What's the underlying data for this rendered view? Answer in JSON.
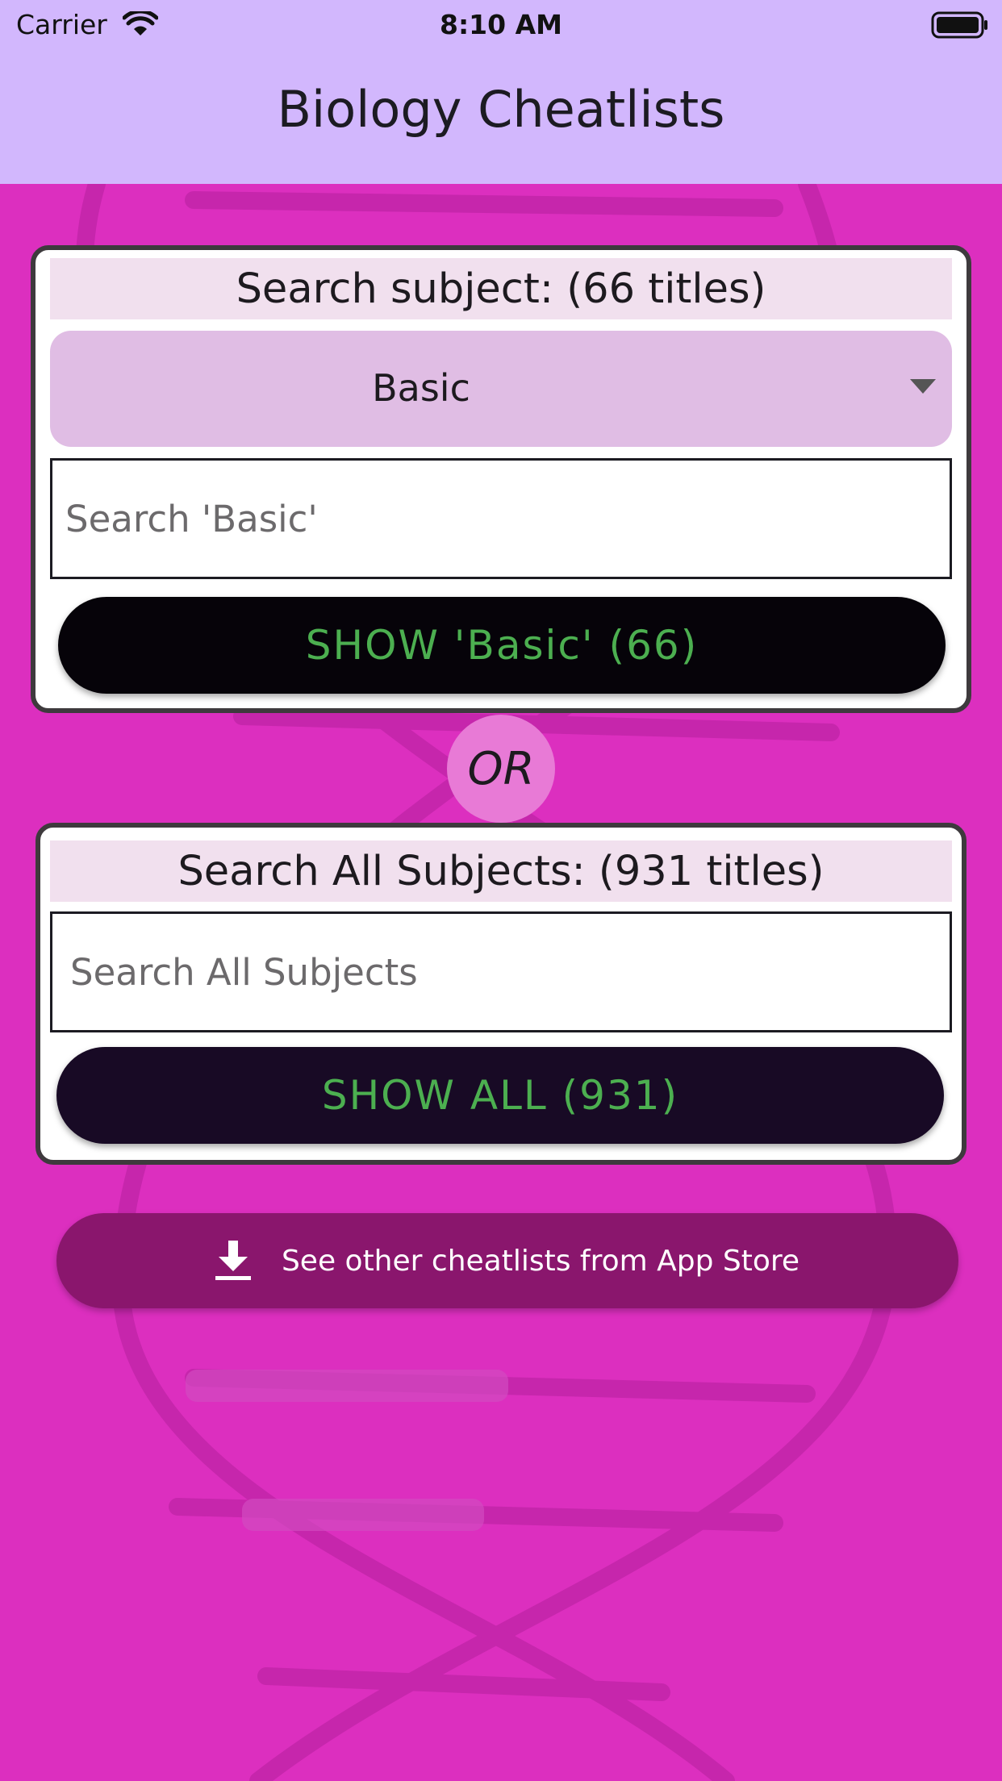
{
  "status_bar": {
    "carrier": "Carrier",
    "time": "8:10 AM",
    "icons": [
      "wifi-icon",
      "battery-icon"
    ]
  },
  "app_bar": {
    "title": "Biology Cheatlists"
  },
  "subject_section": {
    "header": "Search subject: (66 titles)",
    "dropdown": {
      "selected": "Basic",
      "icon": "dropdown-arrow-icon"
    },
    "search": {
      "value": "",
      "placeholder": "Search 'Basic'"
    },
    "show_button": "SHOW 'Basic' (66)"
  },
  "divider": {
    "label": "OR"
  },
  "all_section": {
    "header": "Search All Subjects: (931 titles)",
    "search": {
      "value": "",
      "placeholder": "Search All Subjects"
    },
    "show_button": "SHOW ALL (931)"
  },
  "store_button": {
    "label": "See other cheatlists from App Store",
    "icon": "download-icon"
  },
  "colors": {
    "app_bar": "#d2b7fd",
    "background": "#dc2fbf",
    "button_text": "#4caf50",
    "store_button": "#8a166d",
    "or_circle": "#e87ad6"
  }
}
